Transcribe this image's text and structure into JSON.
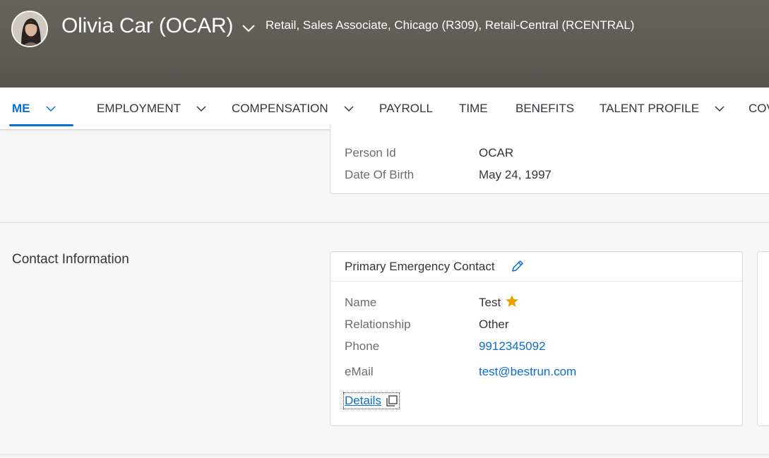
{
  "header": {
    "employee_name": "Olivia Car (OCAR)",
    "employee_subtitle": "Retail, Sales Associate, Chicago (R309), Retail-Central (RCENTRAL)"
  },
  "nav": {
    "tabs": [
      {
        "label": "ME",
        "active": true,
        "has_dropdown": true
      },
      {
        "label": "EMPLOYMENT",
        "active": false,
        "has_dropdown": true
      },
      {
        "label": "COMPENSATION",
        "active": false,
        "has_dropdown": true
      },
      {
        "label": "PAYROLL",
        "active": false,
        "has_dropdown": false
      },
      {
        "label": "TIME",
        "active": false,
        "has_dropdown": false
      },
      {
        "label": "BENEFITS",
        "active": false,
        "has_dropdown": false
      },
      {
        "label": "TALENT PROFILE",
        "active": false,
        "has_dropdown": true
      },
      {
        "label": "COV",
        "active": false,
        "has_dropdown": false
      }
    ]
  },
  "personal_card": {
    "fields": [
      {
        "label": "Person Id",
        "value": "OCAR"
      },
      {
        "label": "Date Of Birth",
        "value": "May 24, 1997"
      }
    ]
  },
  "contact_section": {
    "title": "Contact Information",
    "emergency_card": {
      "title": "Primary Emergency Contact",
      "fields": [
        {
          "label": "Name",
          "value": "Test",
          "primary_star": true
        },
        {
          "label": "Relationship",
          "value": "Other"
        },
        {
          "label": "Phone",
          "value": "9912345092",
          "is_link": true
        },
        {
          "label": "eMail",
          "value": "test@bestrun.com",
          "is_link": true
        }
      ],
      "details_link": "Details"
    }
  },
  "colors": {
    "header_bg": "#5d5c53",
    "accent": "#0a6ed1",
    "star": "#e9a300",
    "label": "#6a6d70",
    "text": "#32363a"
  },
  "icons": {
    "name_dropdown": "chevron-down-icon",
    "tab_dropdown": "chevron-down-icon",
    "edit": "pencil-icon",
    "primary": "star-icon",
    "details": "copy-icon"
  }
}
